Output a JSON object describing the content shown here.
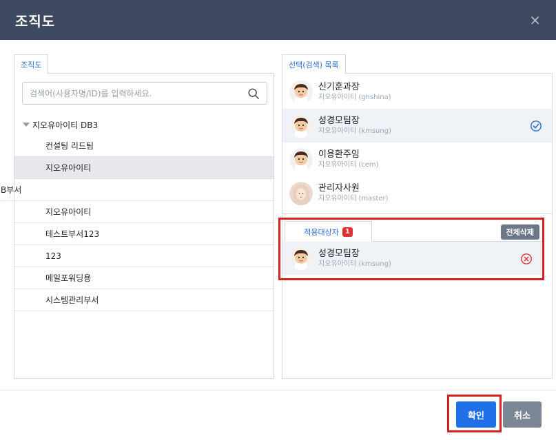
{
  "modal": {
    "title": "조직도",
    "close_symbol": "×"
  },
  "left_panel": {
    "tab_label": "조직도",
    "search_placeholder": "검색어(사용자명/ID)를 입력하세요.",
    "search_icon": "search-icon",
    "tree": {
      "root_label": "지오유아이티 DB3",
      "items": [
        {
          "label": "컨설팅 리드팀",
          "selected": false
        },
        {
          "label": "지오유아이티",
          "selected": true
        },
        {
          "label": "B부서",
          "selected": false
        },
        {
          "label": "지오유아이티",
          "selected": false
        },
        {
          "label": "테스트부서123",
          "selected": false
        },
        {
          "label": "123",
          "selected": false
        },
        {
          "label": "메일포워딩용",
          "selected": false
        },
        {
          "label": "시스템관리부서",
          "selected": false
        }
      ]
    }
  },
  "right_panel": {
    "tab_label": "선택(검색) 목록",
    "people": [
      {
        "name": "신기훈과장",
        "sub": "지오유아이티 (ghshina)",
        "checked": false
      },
      {
        "name": "성경모팀장",
        "sub": "지오유아이티 (kmsung)",
        "checked": true
      },
      {
        "name": "이용환주임",
        "sub": "지오유아이티 (cem)",
        "checked": false
      },
      {
        "name": "관리자사원",
        "sub": "지오유아이티 (master)",
        "checked": false
      }
    ]
  },
  "target_panel": {
    "tab_label": "적용대상자",
    "badge_count": "1",
    "delete_all_label": "전체삭제",
    "people": [
      {
        "name": "성경모팀장",
        "sub": "지오유아이티 (kmsung)"
      }
    ]
  },
  "footer": {
    "confirm_label": "확인",
    "cancel_label": "취소"
  },
  "colors": {
    "header_bg": "#3d4961",
    "accent_blue": "#1f6fe8",
    "highlight_red": "#d42020",
    "cancel_gray": "#7c8795"
  }
}
